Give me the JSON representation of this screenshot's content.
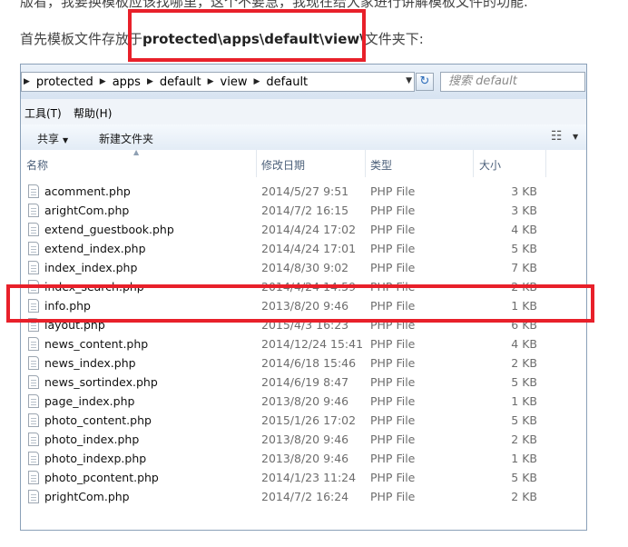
{
  "article": {
    "top_line": "版看，我要换模板应该找哪里，这个不要急，我现在给大家进行讲解模板文件的功能.",
    "intro_prefix": "首先模板文件存放于",
    "intro_path": "protected\\apps\\default\\view\\",
    "intro_suffix": "文件夹下:"
  },
  "explorer": {
    "address": {
      "crumbs": [
        "protected",
        "apps",
        "default",
        "view",
        "default"
      ]
    },
    "search": {
      "placeholder": "搜索 default"
    },
    "menu": [
      "工具(T)",
      "帮助(H)"
    ],
    "toolbar": {
      "share_label": "共享",
      "new_folder_label": "新建文件夹"
    },
    "columns": {
      "name": "名称",
      "date": "修改日期",
      "type": "类型",
      "size": "大小"
    },
    "files": [
      {
        "name": "acomment.php",
        "date": "2014/5/27 9:51",
        "type": "PHP File",
        "size": "3 KB"
      },
      {
        "name": "arightCom.php",
        "date": "2014/7/2 16:15",
        "type": "PHP File",
        "size": "3 KB"
      },
      {
        "name": "extend_guestbook.php",
        "date": "2014/4/24 17:02",
        "type": "PHP File",
        "size": "4 KB"
      },
      {
        "name": "extend_index.php",
        "date": "2014/4/24 17:01",
        "type": "PHP File",
        "size": "5 KB"
      },
      {
        "name": "index_index.php",
        "date": "2014/8/30 9:02",
        "type": "PHP File",
        "size": "7 KB"
      },
      {
        "name": "index_search.php",
        "date": "2014/4/24 14:59",
        "type": "PHP File",
        "size": "2 KB"
      },
      {
        "name": "info.php",
        "date": "2013/8/20 9:46",
        "type": "PHP File",
        "size": "1 KB"
      },
      {
        "name": "layout.php",
        "date": "2015/4/3 16:23",
        "type": "PHP File",
        "size": "6 KB"
      },
      {
        "name": "news_content.php",
        "date": "2014/12/24 15:41",
        "type": "PHP File",
        "size": "4 KB"
      },
      {
        "name": "news_index.php",
        "date": "2014/6/18 15:46",
        "type": "PHP File",
        "size": "2 KB"
      },
      {
        "name": "news_sortindex.php",
        "date": "2014/6/19 8:47",
        "type": "PHP File",
        "size": "5 KB"
      },
      {
        "name": "page_index.php",
        "date": "2013/8/20 9:46",
        "type": "PHP File",
        "size": "1 KB"
      },
      {
        "name": "photo_content.php",
        "date": "2015/1/26 17:02",
        "type": "PHP File",
        "size": "5 KB"
      },
      {
        "name": "photo_index.php",
        "date": "2013/8/20 9:46",
        "type": "PHP File",
        "size": "2 KB"
      },
      {
        "name": "photo_indexp.php",
        "date": "2013/8/20 9:46",
        "type": "PHP File",
        "size": "1 KB"
      },
      {
        "name": "photo_pcontent.php",
        "date": "2014/1/23 11:24",
        "type": "PHP File",
        "size": "5 KB"
      },
      {
        "name": "prightCom.php",
        "date": "2014/7/2 16:24",
        "type": "PHP File",
        "size": "2 KB"
      }
    ]
  },
  "colors": {
    "highlight_border": "#e8202a",
    "window_border": "#8aa0b8"
  }
}
